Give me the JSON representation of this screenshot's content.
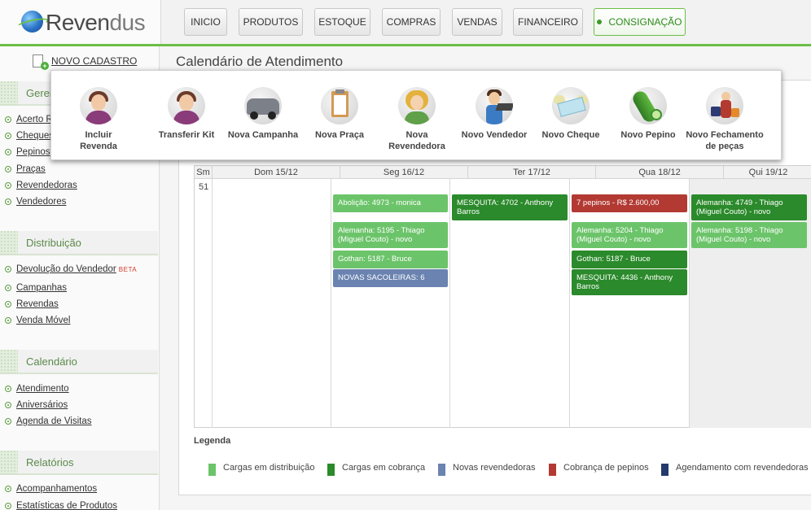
{
  "brand": {
    "name_main": "Reven",
    "name_accent": "dus"
  },
  "nav": [
    {
      "label": "INICIO"
    },
    {
      "label": "PRODUTOS"
    },
    {
      "label": "ESTOQUE"
    },
    {
      "label": "COMPRAS"
    },
    {
      "label": "VENDAS"
    },
    {
      "label": "FINANCEIRO"
    },
    {
      "label": "CONSIGNAÇÃO",
      "active": true
    }
  ],
  "sidebar": {
    "novo_cadastro": "NOVO CADASTRO",
    "sections": [
      {
        "title": "Geren",
        "items": [
          {
            "label": "Acerto R"
          },
          {
            "label": "Cheques"
          },
          {
            "label": "Pepinos"
          },
          {
            "label": "Praças"
          },
          {
            "label": "Revendedoras"
          },
          {
            "label": "Vendedores"
          }
        ]
      },
      {
        "title": "Distribuição",
        "items": [
          {
            "label": "Devolução do Vendedor",
            "badge": "BETA"
          },
          {
            "label": "Campanhas"
          },
          {
            "label": "Revendas"
          },
          {
            "label": "Venda Móvel"
          }
        ]
      },
      {
        "title": "Calendário",
        "items": [
          {
            "label": "Atendimento"
          },
          {
            "label": "Aniversários"
          },
          {
            "label": "Agenda de Visitas"
          }
        ]
      },
      {
        "title": "Relatórios",
        "items": [
          {
            "label": "Acompanhamentos"
          },
          {
            "label": "Estatísticas de Produtos"
          }
        ]
      }
    ]
  },
  "page_title": "Calendário de Atendimento",
  "popup": {
    "items": [
      {
        "label": "Incluir Revenda",
        "icon": "woman-profile-icon"
      },
      {
        "label": "Transferir Kit",
        "icon": "woman-profile-icon"
      },
      {
        "label": "Nova Campanha",
        "icon": "car-trunk-icon"
      },
      {
        "label": "Nova Praça",
        "icon": "clipboard-icon"
      },
      {
        "label": "Nova Revendedora",
        "icon": "blonde-woman-icon"
      },
      {
        "label": "Novo Vendedor",
        "icon": "salesman-laptop-icon"
      },
      {
        "label": "Novo Cheque",
        "icon": "winged-cheque-icon"
      },
      {
        "label": "Novo Pepino",
        "icon": "cucumber-icon"
      },
      {
        "label": "Novo Fechamento de peças",
        "icon": "shopper-bags-icon"
      }
    ]
  },
  "calendar": {
    "week_header": "Sm",
    "week_number": "51",
    "days": [
      "Dom 15/12",
      "Seg 16/12",
      "Ter 17/12",
      "Qua 18/12",
      "Qui 19/12"
    ],
    "events": {
      "seg": [
        {
          "text": "Abolição: 4973 - monica",
          "type": "distribuicao"
        },
        {
          "text": "Alemanha: 5195 - Thiago (Miguel Couto) - novo",
          "type": "distribuicao"
        },
        {
          "text": "Gothan: 5187 - Bruce",
          "type": "distribuicao"
        },
        {
          "text": "NOVAS SACOLEIRAS: 6",
          "type": "novas"
        }
      ],
      "ter": [
        {
          "text": "MESQUITA: 4702 - Anthony Barros",
          "type": "cobranca"
        }
      ],
      "qua": [
        {
          "text": "7 pepinos - R$ 2.600,00",
          "type": "pepinos"
        },
        {
          "text": "Alemanha: 5204 - Thiago (Miguel Couto) - novo",
          "type": "distribuicao"
        },
        {
          "text": "Gothan: 5187 - Bruce",
          "type": "cobranca"
        },
        {
          "text": "MESQUITA: 4436 - Anthony Barros",
          "type": "cobranca"
        }
      ],
      "qui": [
        {
          "text": "Alemanha: 4749 - Thiago (Miguel Couto) - novo",
          "type": "cobranca"
        },
        {
          "text": "Alemanha: 5198 - Thiago (Miguel Couto) - novo",
          "type": "distribuicao"
        }
      ]
    }
  },
  "legend": {
    "title": "Legenda",
    "items": [
      {
        "label": "Cargas em distribuição",
        "color": "#6cc46a"
      },
      {
        "label": "Cargas em cobrança",
        "color": "#2b8a2b"
      },
      {
        "label": "Novas revendedoras",
        "color": "#6a83b0"
      },
      {
        "label": "Cobrança de pepinos",
        "color": "#b23a33"
      },
      {
        "label": "Agendamento com revendedoras",
        "color": "#233a6a"
      }
    ]
  },
  "colors": {
    "distribuicao": "#6cc46a",
    "cobranca": "#2b8a2b",
    "novas": "#6a83b0",
    "pepinos": "#b23a33",
    "agendamento": "#233a6a",
    "accent": "#6bbf45"
  }
}
